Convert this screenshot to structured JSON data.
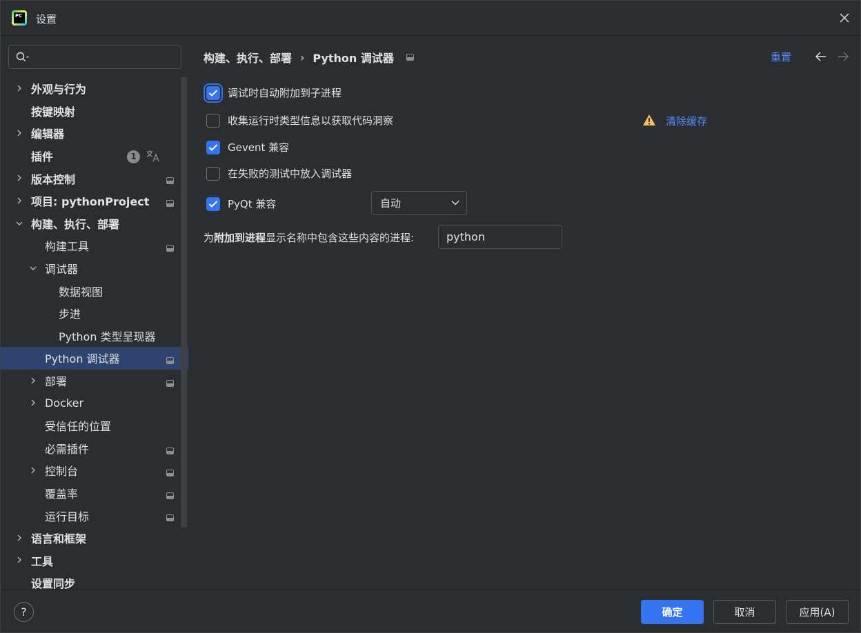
{
  "window": {
    "title": "设置",
    "logo_text": "PC"
  },
  "search": {
    "placeholder": "",
    "value": ""
  },
  "sidebar": {
    "items": [
      {
        "label": "外观与行为",
        "level": 0,
        "expandable": true,
        "expanded": false,
        "bold": true,
        "mark": false
      },
      {
        "label": "按键映射",
        "level": 0,
        "expandable": false,
        "bold": true,
        "mark": false
      },
      {
        "label": "编辑器",
        "level": 0,
        "expandable": true,
        "expanded": false,
        "bold": true,
        "mark": false
      },
      {
        "label": "插件",
        "level": 0,
        "expandable": false,
        "bold": true,
        "mark": false,
        "badge": "1",
        "translate_icon": true
      },
      {
        "label": "版本控制",
        "level": 0,
        "expandable": true,
        "expanded": false,
        "bold": true,
        "mark": true
      },
      {
        "label": "项目: pythonProject",
        "level": 0,
        "expandable": true,
        "expanded": false,
        "bold": true,
        "mark": true
      },
      {
        "label": "构建、执行、部署",
        "level": 0,
        "expandable": true,
        "expanded": true,
        "bold": true,
        "mark": false
      },
      {
        "label": "构建工具",
        "level": 1,
        "expandable": false,
        "bold": false,
        "mark": true
      },
      {
        "label": "调试器",
        "level": 1,
        "expandable": true,
        "expanded": true,
        "bold": false,
        "mark": false
      },
      {
        "label": "数据视图",
        "level": 2,
        "expandable": false,
        "bold": false,
        "mark": false
      },
      {
        "label": "步进",
        "level": 2,
        "expandable": false,
        "bold": false,
        "mark": false
      },
      {
        "label": "Python 类型呈现器",
        "level": 2,
        "expandable": false,
        "bold": false,
        "mark": false
      },
      {
        "label": "Python 调试器",
        "level": 1,
        "expandable": false,
        "bold": false,
        "mark": true,
        "selected": true
      },
      {
        "label": "部署",
        "level": 1,
        "expandable": true,
        "expanded": false,
        "bold": false,
        "mark": true
      },
      {
        "label": "Docker",
        "level": 1,
        "expandable": true,
        "expanded": false,
        "bold": false,
        "mark": false
      },
      {
        "label": "受信任的位置",
        "level": 1,
        "expandable": false,
        "bold": false,
        "mark": false
      },
      {
        "label": "必需插件",
        "level": 1,
        "expandable": false,
        "bold": false,
        "mark": true
      },
      {
        "label": "控制台",
        "level": 1,
        "expandable": true,
        "expanded": false,
        "bold": false,
        "mark": true
      },
      {
        "label": "覆盖率",
        "level": 1,
        "expandable": false,
        "bold": false,
        "mark": true
      },
      {
        "label": "运行目标",
        "level": 1,
        "expandable": false,
        "bold": false,
        "mark": true
      },
      {
        "label": "语言和框架",
        "level": 0,
        "expandable": true,
        "expanded": false,
        "bold": true,
        "mark": false
      },
      {
        "label": "工具",
        "level": 0,
        "expandable": true,
        "expanded": false,
        "bold": true,
        "mark": false
      },
      {
        "label": "设置同步",
        "level": 0,
        "expandable": false,
        "bold": true,
        "mark": false
      }
    ]
  },
  "header": {
    "breadcrumb_parent": "构建、执行、部署",
    "breadcrumb_sep": "›",
    "breadcrumb_current": "Python 调试器",
    "reset_label": "重置"
  },
  "options": {
    "attach_subprocess": {
      "label": "调试时自动附加到子进程",
      "checked": true
    },
    "collect_types": {
      "label": "收集运行时类型信息以获取代码洞察",
      "checked": false
    },
    "clear_cache_label": "清除缓存",
    "gevent": {
      "label": "Gevent 兼容",
      "checked": true
    },
    "drop_into_debugger": {
      "label": "在失败的测试中放入调试器",
      "checked": false
    },
    "pyqt": {
      "label": "PyQt 兼容",
      "checked": true,
      "selected_value": "自动"
    },
    "process_filter": {
      "label_prefix": "为",
      "label_bold": "附加到进程",
      "label_suffix": "显示名称中包含这些内容的进程:",
      "value": "python"
    }
  },
  "footer": {
    "help_label": "?",
    "ok_label": "确定",
    "cancel_label": "取消",
    "apply_label": "应用(A)"
  },
  "colors": {
    "accent": "#3574f0",
    "link": "#548af7",
    "selection": "#2e436e",
    "background": "#2b2d30",
    "warning": "#f2c55c"
  }
}
